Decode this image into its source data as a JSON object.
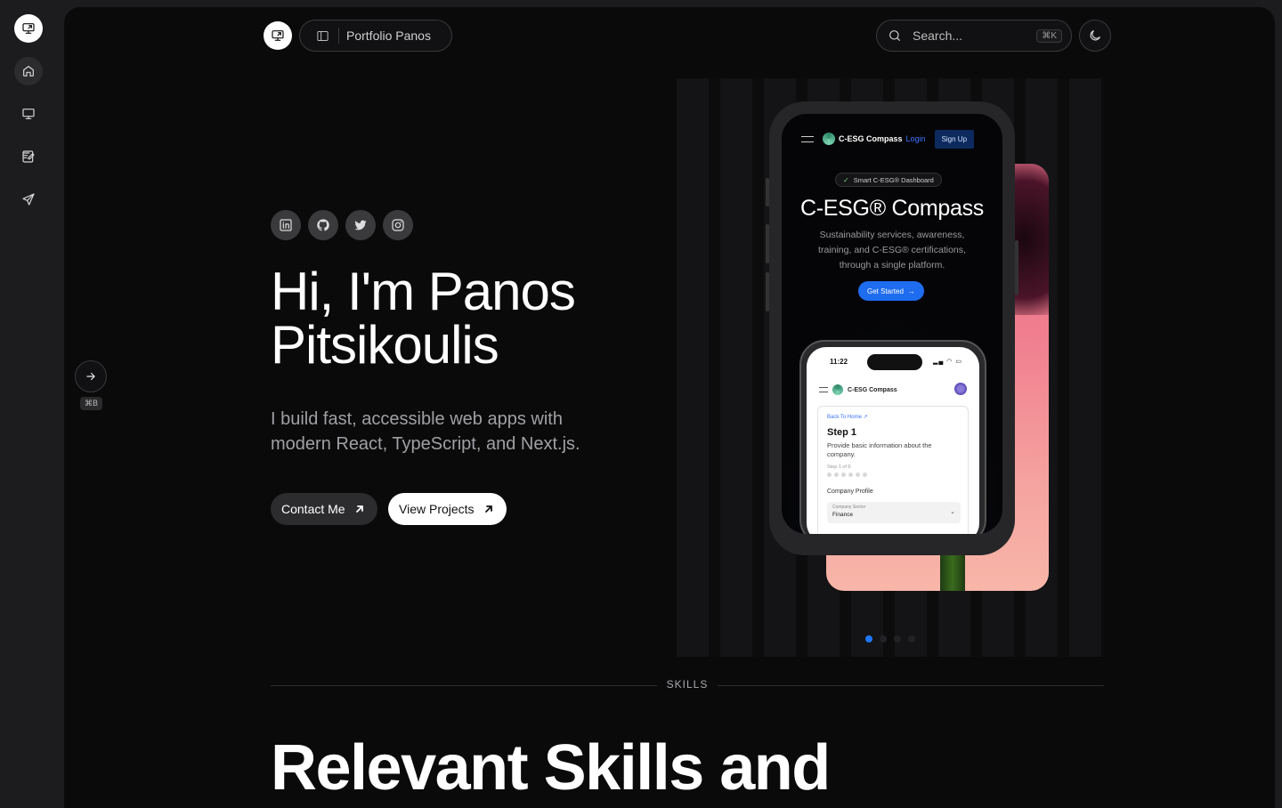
{
  "sidebar": {
    "icons": [
      "monitor-icon",
      "home-icon",
      "presentation-icon",
      "edit-icon",
      "send-icon"
    ]
  },
  "header": {
    "breadcrumb": "Portfolio Panos",
    "search_placeholder": "Search...",
    "search_shortcut": "⌘K"
  },
  "sidebar_toggle": {
    "shortcut": "⌘B"
  },
  "hero": {
    "socials": [
      "linkedin-icon",
      "github-icon",
      "twitter-icon",
      "instagram-icon"
    ],
    "title_line1": "Hi, I'm Panos",
    "title_line2": "Pitsikoulis",
    "subtitle": "I build fast, accessible web apps with modern React, TypeScript, and Next.js.",
    "contact_label": "Contact Me",
    "projects_label": "View Projects"
  },
  "showcase": {
    "brand": "C-ESG Compass",
    "login": "Login",
    "signup": "Sign Up",
    "badge": "Smart C-ESG® Dashboard",
    "title": "C-ESG® Compass",
    "description": "Sustainability services, awareness, training, and C-ESG® certifications, through a single platform.",
    "cta": "Get Started",
    "inner": {
      "time": "11:22",
      "brand": "C-ESG Compass",
      "back": "Back To Home",
      "step": "Step 1",
      "step_desc": "Provide basic information about the company.",
      "step_of": "Step 1 of 6",
      "profile": "Company Profile",
      "sector_label": "Company Sector",
      "sector_value": "Finance"
    },
    "slides": 4,
    "active_slide": 1,
    "accent": "#1e78ff"
  },
  "skills": {
    "label": "SKILLS",
    "title": "Relevant Skills and"
  }
}
